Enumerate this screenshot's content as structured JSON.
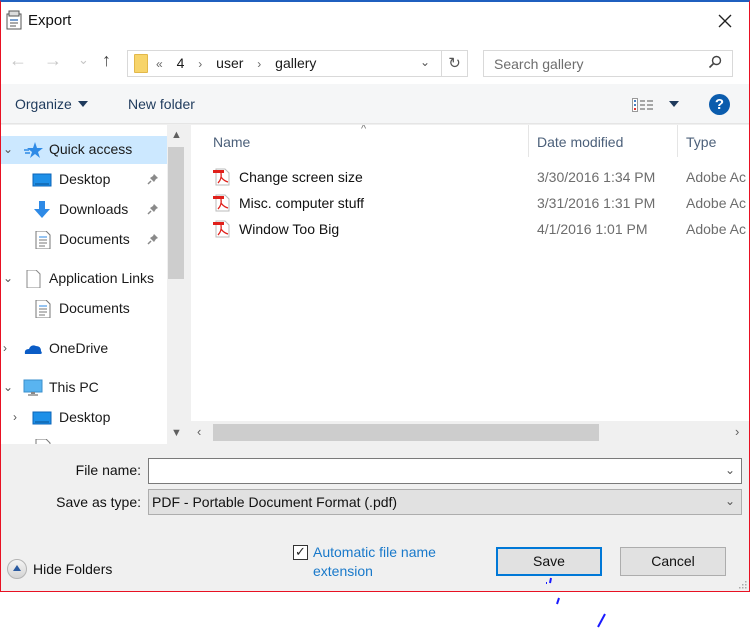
{
  "window": {
    "title": "Export",
    "close_label": "✕"
  },
  "nav": {
    "back_icon": "←",
    "forward_icon": "→",
    "recent_icon": "⌄",
    "up_icon": "↑",
    "breadcrumbs": [
      "«",
      "4",
      "›",
      "user",
      "›",
      "gallery"
    ],
    "address_dropdown_icon": "⌄",
    "refresh_icon": "↻",
    "search_placeholder": "Search gallery"
  },
  "toolbar": {
    "organize_label": "Organize",
    "new_folder_label": "New folder",
    "help_label": "?"
  },
  "sidebar": {
    "items": [
      {
        "label": "Quick access",
        "icon": "star-icon",
        "chevron": "⌄",
        "selected": true
      },
      {
        "label": "Desktop",
        "icon": "desktop-icon",
        "pinned": true
      },
      {
        "label": "Downloads",
        "icon": "download-icon",
        "pinned": true
      },
      {
        "label": "Documents",
        "icon": "document-icon",
        "pinned": true
      },
      {
        "label": "Application Links",
        "icon": "page-icon",
        "chevron": "⌄"
      },
      {
        "label": "Documents",
        "icon": "document-icon"
      },
      {
        "label": "OneDrive",
        "icon": "cloud-icon",
        "chevron": "›"
      },
      {
        "label": "This PC",
        "icon": "computer-icon",
        "chevron": "⌄"
      },
      {
        "label": "Desktop",
        "icon": "desktop-icon",
        "chevron": "›"
      }
    ]
  },
  "filelist": {
    "columns": {
      "name": "Name",
      "date": "Date modified",
      "type": "Type"
    },
    "sort_indicator": "^",
    "rows": [
      {
        "name": "Change screen size",
        "date": "3/30/2016 1:34 PM",
        "type": "Adobe Ac"
      },
      {
        "name": "Misc. computer stuff",
        "date": "3/31/2016 1:31 PM",
        "type": "Adobe Ac"
      },
      {
        "name": "Window Too Big",
        "date": "4/1/2016 1:01 PM",
        "type": "Adobe Ac"
      }
    ]
  },
  "form": {
    "file_name_label": "File name:",
    "file_name_value": "",
    "save_type_label": "Save as type:",
    "save_type_value": "PDF - Portable Document Format (.pdf)",
    "dropdown_icon": "⌄"
  },
  "footer": {
    "hide_folders_label": "Hide Folders",
    "auto_ext_label": "Automatic file name extension",
    "auto_ext_checked": true,
    "save_label": "Save",
    "cancel_label": "Cancel"
  },
  "colors": {
    "accent": "#0078d7",
    "selection": "#cce8ff",
    "link": "#1979ca",
    "annotation_border": "#e81123"
  }
}
